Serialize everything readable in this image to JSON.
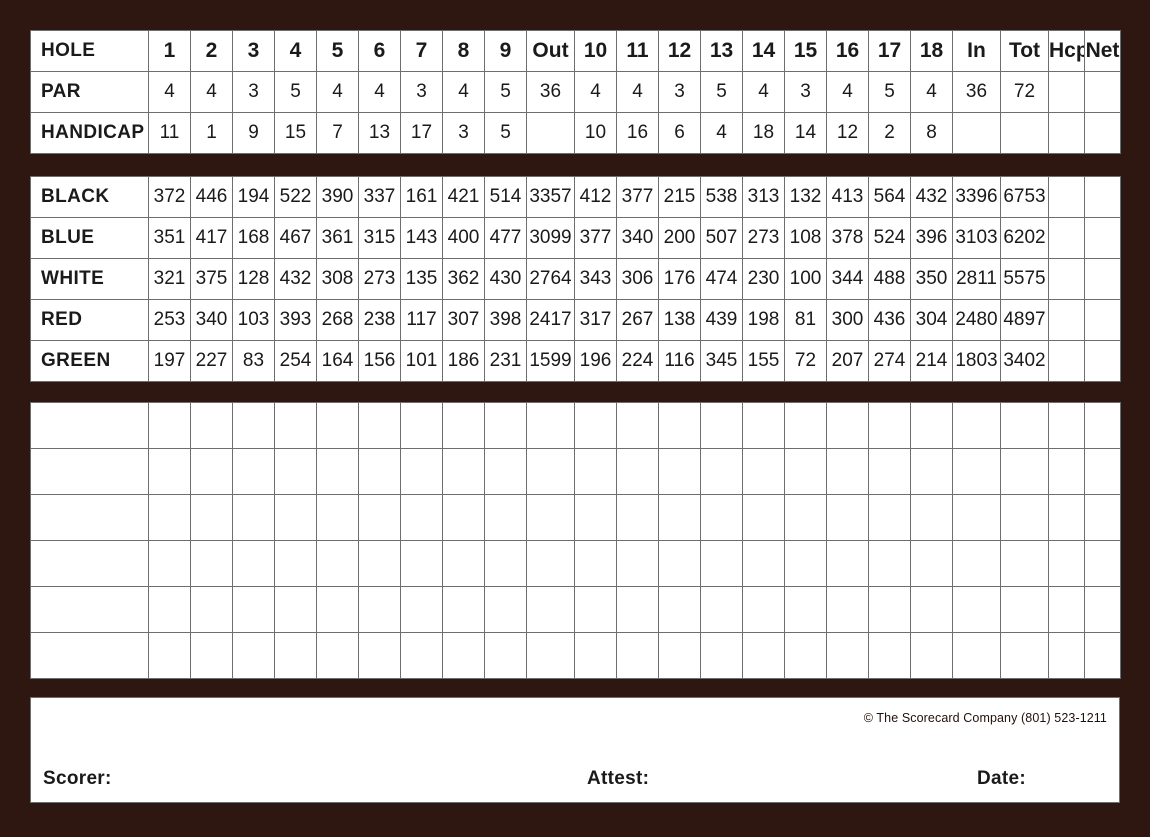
{
  "card": {
    "frame_color": "#2e1710",
    "paper_color": "#ffffff",
    "gridline_color": "#6e6e6e"
  },
  "header": {
    "row_labels": [
      "HOLE",
      "PAR",
      "HANDICAP"
    ],
    "columns": [
      "1",
      "2",
      "3",
      "4",
      "5",
      "6",
      "7",
      "8",
      "9",
      "Out",
      "10",
      "11",
      "12",
      "13",
      "14",
      "15",
      "16",
      "17",
      "18",
      "In",
      "Tot",
      "Hcp",
      "Net"
    ],
    "par": [
      "4",
      "4",
      "3",
      "5",
      "4",
      "4",
      "3",
      "4",
      "5",
      "36",
      "4",
      "4",
      "3",
      "5",
      "4",
      "3",
      "4",
      "5",
      "4",
      "36",
      "72",
      "",
      ""
    ],
    "handicap": [
      "11",
      "1",
      "9",
      "15",
      "7",
      "13",
      "17",
      "3",
      "5",
      "",
      "10",
      "16",
      "6",
      "4",
      "18",
      "14",
      "12",
      "2",
      "8",
      "",
      "",
      "",
      ""
    ]
  },
  "yardage": {
    "rows": [
      {
        "tee": "BLACK",
        "values": [
          "372",
          "446",
          "194",
          "522",
          "390",
          "337",
          "161",
          "421",
          "514",
          "3357",
          "412",
          "377",
          "215",
          "538",
          "313",
          "132",
          "413",
          "564",
          "432",
          "3396",
          "6753",
          "",
          ""
        ]
      },
      {
        "tee": "BLUE",
        "values": [
          "351",
          "417",
          "168",
          "467",
          "361",
          "315",
          "143",
          "400",
          "477",
          "3099",
          "377",
          "340",
          "200",
          "507",
          "273",
          "108",
          "378",
          "524",
          "396",
          "3103",
          "6202",
          "",
          ""
        ]
      },
      {
        "tee": "WHITE",
        "values": [
          "321",
          "375",
          "128",
          "432",
          "308",
          "273",
          "135",
          "362",
          "430",
          "2764",
          "343",
          "306",
          "176",
          "474",
          "230",
          "100",
          "344",
          "488",
          "350",
          "2811",
          "5575",
          "",
          ""
        ]
      },
      {
        "tee": "RED",
        "values": [
          "253",
          "340",
          "103",
          "393",
          "268",
          "238",
          "117",
          "307",
          "398",
          "2417",
          "317",
          "267",
          "138",
          "439",
          "198",
          "81",
          "300",
          "436",
          "304",
          "2480",
          "4897",
          "",
          ""
        ]
      },
      {
        "tee": "GREEN",
        "values": [
          "197",
          "227",
          "83",
          "254",
          "164",
          "156",
          "101",
          "186",
          "231",
          "1599",
          "196",
          "224",
          "116",
          "345",
          "155",
          "72",
          "207",
          "274",
          "214",
          "1803",
          "3402",
          "",
          ""
        ]
      }
    ]
  },
  "scoring_grid": {
    "row_count": 6,
    "column_count": 24,
    "rows": [
      [
        "",
        "",
        "",
        "",
        "",
        "",
        "",
        "",
        "",
        "",
        "",
        "",
        "",
        "",
        "",
        "",
        "",
        "",
        "",
        "",
        "",
        "",
        "",
        ""
      ],
      [
        "",
        "",
        "",
        "",
        "",
        "",
        "",
        "",
        "",
        "",
        "",
        "",
        "",
        "",
        "",
        "",
        "",
        "",
        "",
        "",
        "",
        "",
        "",
        ""
      ],
      [
        "",
        "",
        "",
        "",
        "",
        "",
        "",
        "",
        "",
        "",
        "",
        "",
        "",
        "",
        "",
        "",
        "",
        "",
        "",
        "",
        "",
        "",
        "",
        ""
      ],
      [
        "",
        "",
        "",
        "",
        "",
        "",
        "",
        "",
        "",
        "",
        "",
        "",
        "",
        "",
        "",
        "",
        "",
        "",
        "",
        "",
        "",
        "",
        "",
        ""
      ],
      [
        "",
        "",
        "",
        "",
        "",
        "",
        "",
        "",
        "",
        "",
        "",
        "",
        "",
        "",
        "",
        "",
        "",
        "",
        "",
        "",
        "",
        "",
        "",
        ""
      ],
      [
        "",
        "",
        "",
        "",
        "",
        "",
        "",
        "",
        "",
        "",
        "",
        "",
        "",
        "",
        "",
        "",
        "",
        "",
        "",
        "",
        "",
        "",
        "",
        ""
      ]
    ]
  },
  "footer": {
    "copyright": "© The Scorecard Company  (801) 523-1211",
    "scorer_label": "Scorer:",
    "attest_label": "Attest:",
    "date_label": "Date:"
  }
}
